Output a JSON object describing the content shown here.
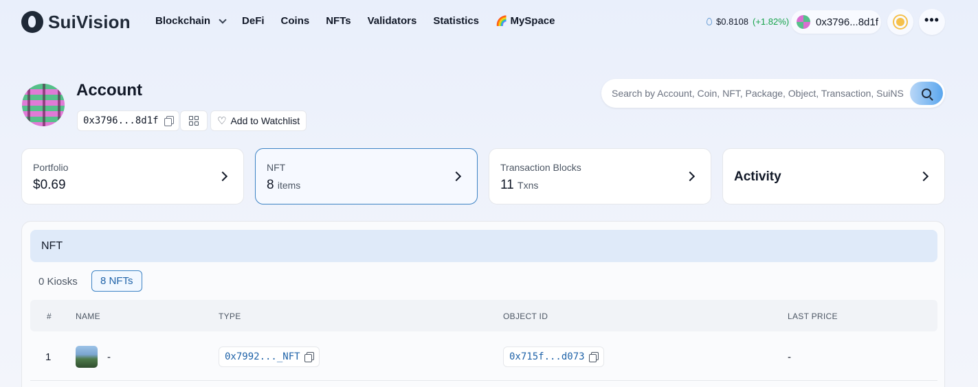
{
  "header": {
    "brand": "SuiVision",
    "nav": [
      {
        "label": "Blockchain"
      },
      {
        "label": "DeFi"
      },
      {
        "label": "Coins"
      },
      {
        "label": "NFTs"
      },
      {
        "label": "Validators"
      },
      {
        "label": "Statistics"
      },
      {
        "label": "MySpace",
        "prefix": "🌈"
      }
    ],
    "price": "$0.8108",
    "price_change": "(+1.82%)",
    "account_short": "0x3796...8d1f"
  },
  "account": {
    "title": "Account",
    "address_short": "0x3796...8d1f",
    "watchlist_label": "Add to Watchlist"
  },
  "search": {
    "placeholder": "Search by Account, Coin, NFT, Package, Object, Transaction, SuiNS"
  },
  "cards": [
    {
      "label": "Portfolio",
      "value": "$0.69",
      "unit": ""
    },
    {
      "label": "NFT",
      "value": "8",
      "unit": "items"
    },
    {
      "label": "Transaction Blocks",
      "value": "11",
      "unit": "Txns"
    },
    {
      "label": "Activity"
    }
  ],
  "nft_panel": {
    "title": "NFT",
    "tabs": [
      "0 Kiosks",
      "8 NFTs"
    ],
    "columns": [
      "#",
      "NAME",
      "TYPE",
      "OBJECT ID",
      "LAST PRICE"
    ],
    "rows": [
      {
        "index": "1",
        "name": "-",
        "type": "0x7992..._NFT",
        "object_id": "0x715f...d073",
        "last_price": "-"
      }
    ]
  },
  "colors": {
    "accent": "#3b82c4",
    "positive": "#16a34a",
    "link": "#1e62a8"
  }
}
